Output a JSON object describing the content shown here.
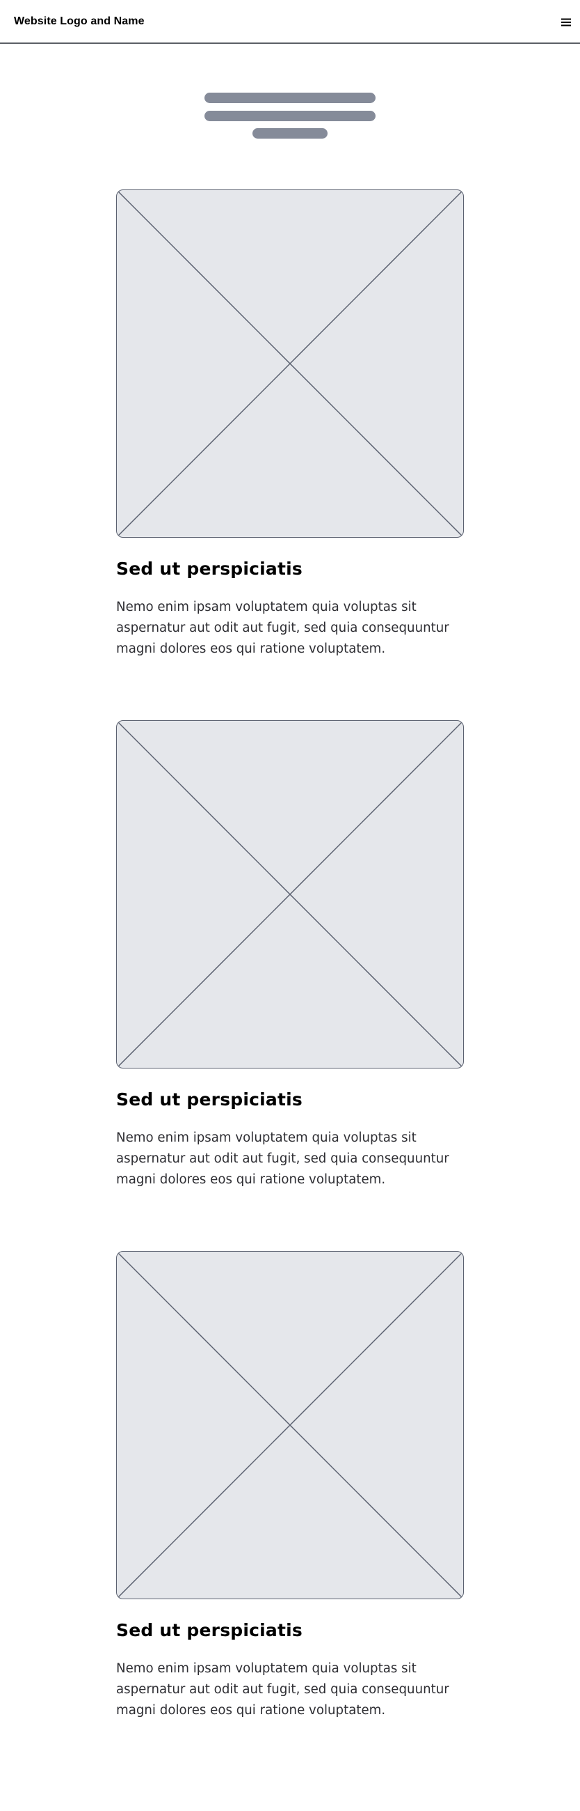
{
  "header": {
    "logo_text": "Website Logo and Name",
    "menu_icon": "hamburger-menu-icon"
  },
  "hero": {
    "title_placeholder_color": "#858b99"
  },
  "cards": [
    {
      "image": "image-placeholder-icon",
      "title": "Sed ut perspiciatis",
      "body": "Nemo enim ipsam voluptatem quia voluptas sit aspernatur aut odit aut fugit, sed quia consequuntur magni dolores eos qui ratione voluptatem."
    },
    {
      "image": "image-placeholder-icon",
      "title": "Sed ut perspiciatis",
      "body": "Nemo enim ipsam voluptatem quia voluptas sit aspernatur aut odit aut fugit, sed quia consequuntur magni dolores eos qui ratione voluptatem."
    },
    {
      "image": "image-placeholder-icon",
      "title": "Sed ut perspiciatis",
      "body": "Nemo enim ipsam voluptatem quia voluptas sit aspernatur aut odit aut fugit, sed quia consequuntur magni dolores eos qui ratione voluptatem."
    }
  ],
  "colors": {
    "placeholder_fill": "#e5e7eb",
    "placeholder_stroke": "#5b6170",
    "header_border": "#5b5f66"
  }
}
